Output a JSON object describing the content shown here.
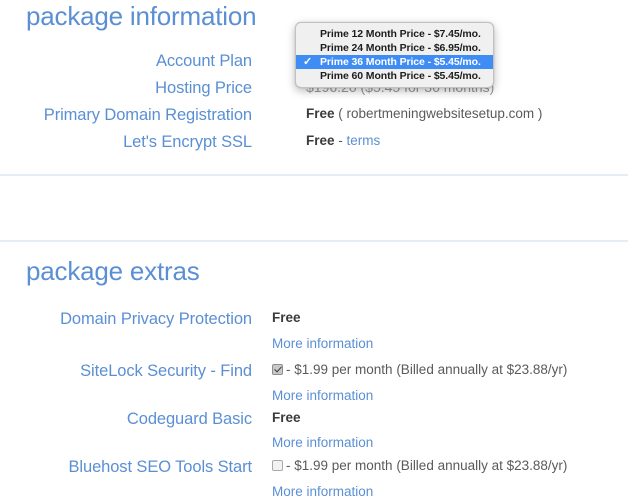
{
  "package_information": {
    "title": "package information",
    "rows": [
      {
        "label": "Account Plan",
        "value": ""
      },
      {
        "label": "Hosting Price",
        "value": "$196.20  ($5.45 for 36 months)"
      },
      {
        "label": "Primary Domain Registration",
        "value_strong": "Free",
        "value_rest": " ( robertmeningwebsitesetup.com )"
      },
      {
        "label": "Let's Encrypt SSL",
        "value_strong": "Free",
        "value_sep": " - ",
        "value_link": "terms"
      }
    ]
  },
  "account_plan_select": {
    "expanded": true,
    "selected_index": 2,
    "options": [
      "Prime 12 Month Price - $7.45/mo.",
      "Prime 24 Month Price - $6.95/mo.",
      "Prime 36 Month Price - $5.45/mo.",
      "Prime 60 Month Price - $5.45/mo."
    ],
    "check_glyph": "✓",
    "highlight_color": "#3e8cf4"
  },
  "package_extras": {
    "title": "package extras",
    "more_information_label": "More information",
    "items": [
      {
        "label": "Domain Privacy Protection",
        "type": "free",
        "value": "Free",
        "more_info": "More information"
      },
      {
        "label": "SiteLock Security - Find",
        "type": "checkbox",
        "checked": true,
        "value": "- $1.99 per month (Billed annually at $23.88/yr)",
        "more_info": "More information"
      },
      {
        "label": "Codeguard Basic",
        "type": "free",
        "value": "Free",
        "more_info": "More information"
      },
      {
        "label": "Bluehost SEO Tools Start",
        "type": "checkbox",
        "checked": false,
        "value": "- $1.99 per month (Billed annually at $23.88/yr)",
        "more_info": "More information"
      }
    ]
  },
  "colors": {
    "label_blue": "#5b8fd4",
    "divider_blue": "#e3edf8",
    "body_text": "#4c4c4c",
    "select_highlight": "#3e8cf4"
  }
}
